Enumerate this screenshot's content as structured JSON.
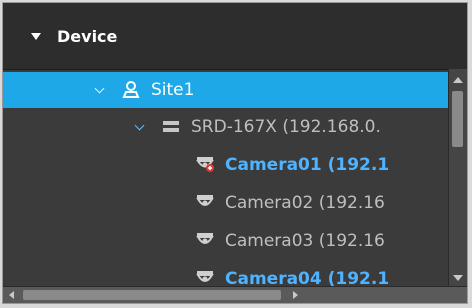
{
  "panel": {
    "title": "Device",
    "title_icon": "caret-down-icon"
  },
  "tree": {
    "items": [
      {
        "label": "Site1",
        "icon": "site-icon",
        "level": 0,
        "expanded": true,
        "selected": true
      },
      {
        "label": "SRD-167X (192.168.0.",
        "icon": "recorder-icon",
        "level": 1,
        "expanded": true,
        "selected": false
      },
      {
        "label": "Camera01 (192.1",
        "icon": "camera-recording-icon",
        "level": 2,
        "selected": false,
        "highlight": true
      },
      {
        "label": "Camera02 (192.16",
        "icon": "camera-icon",
        "level": 2,
        "selected": false,
        "highlight": false
      },
      {
        "label": "Camera03 (192.16",
        "icon": "camera-icon",
        "level": 2,
        "selected": false,
        "highlight": false
      },
      {
        "label": "Camera04 (192.1",
        "icon": "camera-icon",
        "level": 2,
        "selected": false,
        "highlight": true
      }
    ]
  },
  "colors": {
    "selection": "#1fa8e8",
    "highlight_text": "#4fb3ff",
    "background": "#3b3b3b"
  }
}
